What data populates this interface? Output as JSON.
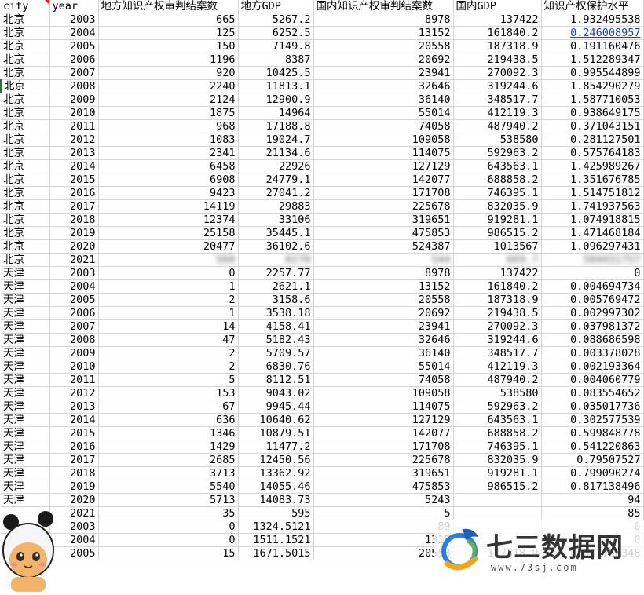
{
  "sheet": {
    "headers": [
      "city",
      "year",
      "地方知识产权审判结案数",
      "地方GDP",
      "国内知识产权审判结案数",
      "国内GDP",
      "知识产权保护水平"
    ],
    "rows": [
      [
        "北京",
        "2003",
        "665",
        "5267.2",
        "8978",
        "137422",
        "1.932495538"
      ],
      [
        "北京",
        "2004",
        "125",
        "6252.5",
        "13152",
        "161840.2",
        "0.246008957"
      ],
      [
        "北京",
        "2005",
        "150",
        "7149.8",
        "20558",
        "187318.9",
        "0.191160476"
      ],
      [
        "北京",
        "2006",
        "1196",
        "8387",
        "20692",
        "219438.5",
        "1.512289347"
      ],
      [
        "北京",
        "2007",
        "920",
        "10425.5",
        "23941",
        "270092.3",
        "0.995544899"
      ],
      [
        "北京",
        "2008",
        "2240",
        "11813.1",
        "32646",
        "319244.6",
        "1.854290279"
      ],
      [
        "北京",
        "2009",
        "2124",
        "12900.9",
        "36140",
        "348517.7",
        "1.587710053"
      ],
      [
        "北京",
        "2010",
        "1875",
        "14964",
        "55014",
        "412119.3",
        "0.938649175"
      ],
      [
        "北京",
        "2011",
        "968",
        "17188.8",
        "74058",
        "487940.2",
        "0.371043151"
      ],
      [
        "北京",
        "2012",
        "1083",
        "19024.7",
        "109058",
        "538580",
        "0.281127501"
      ],
      [
        "北京",
        "2013",
        "2341",
        "21134.6",
        "114075",
        "592963.2",
        "0.575764183"
      ],
      [
        "北京",
        "2014",
        "6458",
        "22926",
        "127129",
        "643563.1",
        "1.425989267"
      ],
      [
        "北京",
        "2015",
        "6908",
        "24779.1",
        "142077",
        "688858.2",
        "1.351676785"
      ],
      [
        "北京",
        "2016",
        "9423",
        "27041.2",
        "171708",
        "746395.1",
        "1.514751812"
      ],
      [
        "北京",
        "2017",
        "14119",
        "29883",
        "225678",
        "832035.9",
        "1.741937563"
      ],
      [
        "北京",
        "2018",
        "12374",
        "33106",
        "319651",
        "919281.1",
        "1.074918815"
      ],
      [
        "北京",
        "2019",
        "25158",
        "35445.1",
        "475853",
        "986515.2",
        "1.471468184"
      ],
      [
        "北京",
        "2020",
        "20477",
        "36102.6",
        "524387",
        "1013567",
        "1.096297431"
      ],
      [
        "北京",
        "2021",
        "560",
        "0270",
        "544",
        "669.7",
        "584431757"
      ],
      [
        "天津",
        "2003",
        "0",
        "2257.77",
        "8978",
        "137422",
        "0"
      ],
      [
        "天津",
        "2004",
        "1",
        "2621.1",
        "13152",
        "161840.2",
        "0.004694734"
      ],
      [
        "天津",
        "2005",
        "2",
        "3158.6",
        "20558",
        "187318.9",
        "0.005769472"
      ],
      [
        "天津",
        "2006",
        "1",
        "3538.18",
        "20692",
        "219438.5",
        "0.002997302"
      ],
      [
        "天津",
        "2007",
        "14",
        "4158.41",
        "23941",
        "270092.3",
        "0.037981372"
      ],
      [
        "天津",
        "2008",
        "47",
        "5182.43",
        "32646",
        "319244.6",
        "0.088686598"
      ],
      [
        "天津",
        "2009",
        "2",
        "5709.57",
        "36140",
        "348517.7",
        "0.003378028"
      ],
      [
        "天津",
        "2010",
        "2",
        "6830.76",
        "55014",
        "412119.3",
        "0.002193364"
      ],
      [
        "天津",
        "2011",
        "5",
        "8112.51",
        "74058",
        "487940.2",
        "0.004060779"
      ],
      [
        "天津",
        "2012",
        "153",
        "9043.02",
        "109058",
        "538580",
        "0.083554652"
      ],
      [
        "天津",
        "2013",
        "67",
        "9945.44",
        "114075",
        "592963.2",
        "0.035017736"
      ],
      [
        "天津",
        "2014",
        "636",
        "10640.62",
        "127129",
        "643563.1",
        "0.302577539"
      ],
      [
        "天津",
        "2015",
        "1346",
        "10879.51",
        "142077",
        "688858.2",
        "0.599848778"
      ],
      [
        "天津",
        "2016",
        "1429",
        "11477.2",
        "171708",
        "746395.1",
        "0.541220863"
      ],
      [
        "天津",
        "2017",
        "2685",
        "12450.56",
        "225678",
        "832035.9",
        "0.79507527"
      ],
      [
        "天津",
        "2018",
        "3713",
        "13362.92",
        "319651",
        "919281.1",
        "0.799090274"
      ],
      [
        "天津",
        "2019",
        "5540",
        "14055.46",
        "475853",
        "986515.2",
        "0.817138496"
      ],
      [
        "天津",
        "2020",
        "5713",
        "14083.73",
        "5243",
        "",
        "94"
      ],
      [
        "",
        "2021",
        "35",
        "595",
        "5",
        "",
        "85"
      ],
      [
        "",
        "2003",
        "0",
        "1324.5121",
        "89",
        "",
        "0"
      ],
      [
        "",
        "2004",
        "0",
        "1511.1521",
        "1315",
        "",
        "0"
      ],
      [
        "",
        "2005",
        "15",
        "1671.5015",
        "20558",
        "187318.9",
        "0.081768348"
      ]
    ]
  },
  "watermark": {
    "brand": "七三数据网",
    "url": "www.73sj.com"
  }
}
